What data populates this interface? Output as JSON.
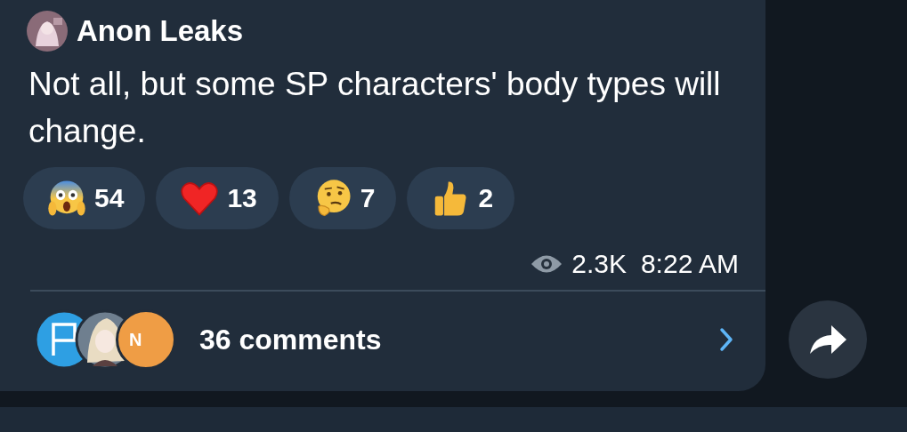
{
  "channel": {
    "name": "Anon Leaks"
  },
  "message": {
    "text": "Not all, but some SP characters' body types will change."
  },
  "reactions": [
    {
      "kind": "scream",
      "count": "54"
    },
    {
      "kind": "heart",
      "count": "13"
    },
    {
      "kind": "thinking",
      "count": "7"
    },
    {
      "kind": "thumbs-up",
      "count": "2"
    }
  ],
  "meta": {
    "views": "2.3K",
    "time": "8:22 AM"
  },
  "comments": {
    "avatars": [
      {
        "kind": "flag"
      },
      {
        "kind": "picture"
      },
      {
        "kind": "letter",
        "letter": "N"
      }
    ],
    "label": "36 comments"
  }
}
